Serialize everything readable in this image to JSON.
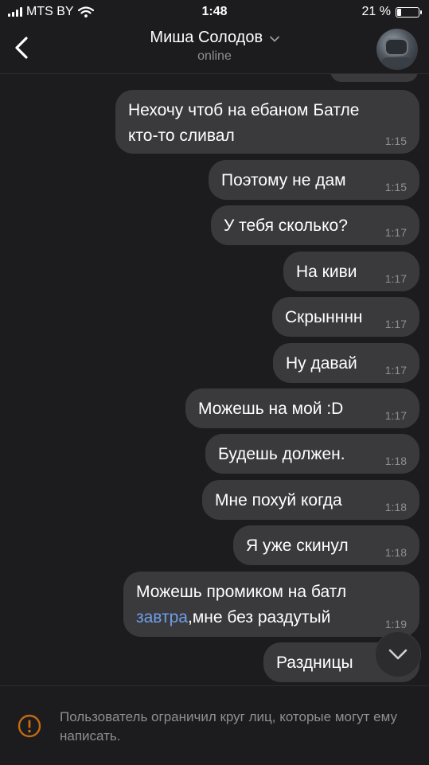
{
  "status_bar": {
    "carrier": "MTS BY",
    "time": "1:48",
    "battery_percent_label": "21 %",
    "battery_level": 0.21
  },
  "header": {
    "contact_name": "Миша Солодов",
    "presence": "online"
  },
  "messages": [
    {
      "lines": [
        "Нехочу чтоб на ебаном Батле",
        "кто-то сливал"
      ],
      "time": "1:15"
    },
    {
      "lines": [
        "Поэтому не дам"
      ],
      "time": "1:15"
    },
    {
      "lines": [
        "У тебя сколько?"
      ],
      "time": "1:17"
    },
    {
      "lines": [
        "На киви"
      ],
      "time": "1:17"
    },
    {
      "lines": [
        "Скрынннн"
      ],
      "time": "1:17"
    },
    {
      "lines": [
        "Ну давай"
      ],
      "time": "1:17"
    },
    {
      "lines": [
        "Можешь на мой :D"
      ],
      "time": "1:17"
    },
    {
      "lines": [
        "Будешь должен."
      ],
      "time": "1:18"
    },
    {
      "lines": [
        "Мне похуй когда"
      ],
      "time": "1:18"
    },
    {
      "lines": [
        "Я уже скинул"
      ],
      "time": "1:18"
    },
    {
      "lines": [
        "Можешь промиком на батл"
      ],
      "link": "завтра",
      "after_link": ",мне без раздутый",
      "time": "1:19"
    },
    {
      "lines": [
        "Раздницы"
      ],
      "time": ""
    }
  ],
  "restriction_notice": {
    "text": "Пользователь ограничил круг лиц, которые могут ему написать."
  },
  "colors": {
    "background": "#1c1c1e",
    "bubble": "#3a3a3c",
    "secondary_text": "#8e8e93",
    "link": "#6f9ee8",
    "warning_icon": "#c46a12"
  }
}
